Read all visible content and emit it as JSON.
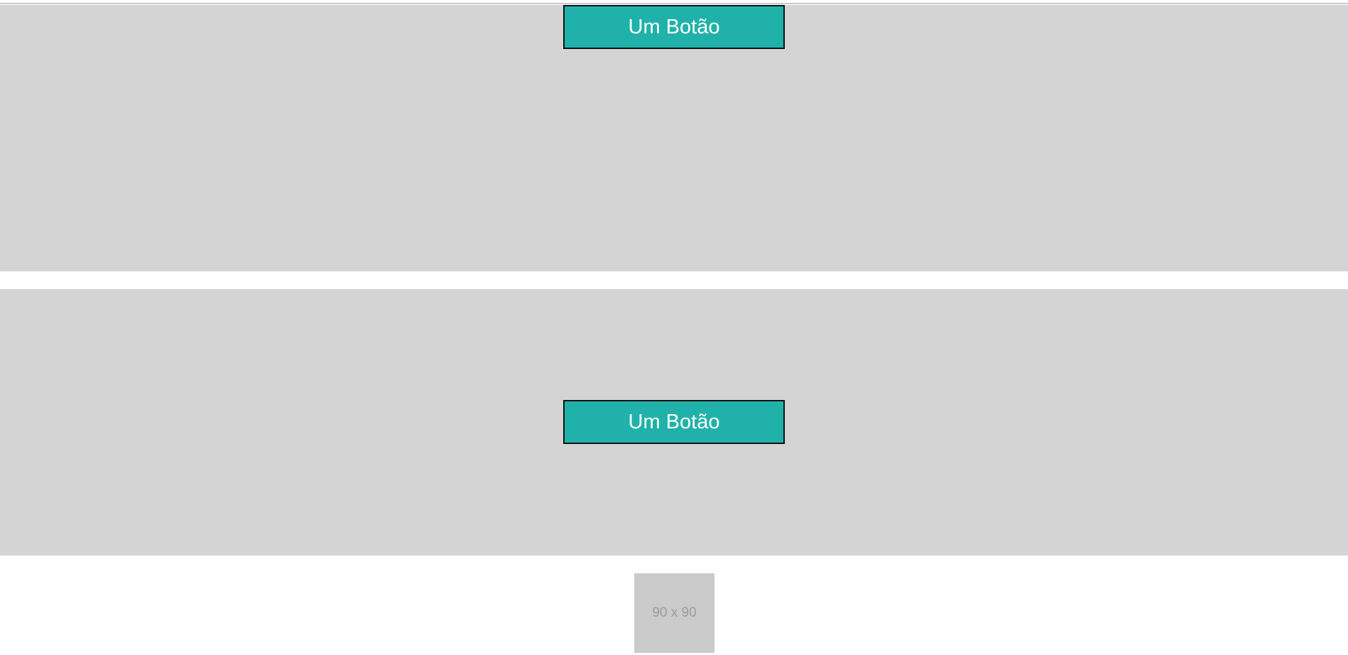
{
  "sections": {
    "top": {
      "button_label": "Um Botão"
    },
    "middle": {
      "button_label": "Um Botão"
    }
  },
  "image_placeholder": {
    "label": "90 x 90"
  },
  "colors": {
    "panel_background": "#d4d4d4",
    "button_background": "#20b2aa",
    "button_text": "#ffffff",
    "button_border": "#111111",
    "placeholder_background": "#cbcbcb",
    "placeholder_text": "#9b9b9b"
  }
}
